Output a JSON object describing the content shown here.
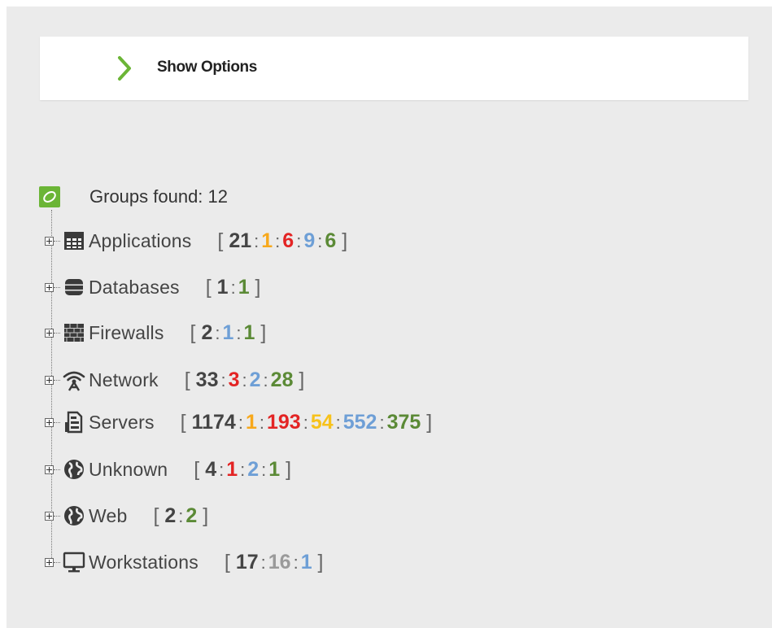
{
  "options": {
    "label": "Show Options"
  },
  "tree": {
    "root_label": "Groups found: 12",
    "groups": [
      {
        "name": "Applications",
        "icon": "applications-grid-icon",
        "counts": [
          {
            "v": "21",
            "c": "#444444"
          },
          {
            "v": "1",
            "c": "#f7a81b"
          },
          {
            "v": "6",
            "c": "#e32424"
          },
          {
            "v": "9",
            "c": "#6e9fd6"
          },
          {
            "v": "6",
            "c": "#5b8a36"
          }
        ]
      },
      {
        "name": "Databases",
        "icon": "database-icon",
        "counts": [
          {
            "v": "1",
            "c": "#444444"
          },
          {
            "v": "1",
            "c": "#5b8a36"
          }
        ]
      },
      {
        "name": "Firewalls",
        "icon": "firewall-brick-icon",
        "counts": [
          {
            "v": "2",
            "c": "#444444"
          },
          {
            "v": "1",
            "c": "#6e9fd6"
          },
          {
            "v": "1",
            "c": "#5b8a36"
          }
        ]
      },
      {
        "name": "Network",
        "icon": "antenna-icon",
        "counts": [
          {
            "v": "33",
            "c": "#444444"
          },
          {
            "v": "3",
            "c": "#e32424"
          },
          {
            "v": "2",
            "c": "#6e9fd6"
          },
          {
            "v": "28",
            "c": "#5b8a36"
          }
        ]
      },
      {
        "name": "Servers",
        "icon": "server-icon",
        "counts": [
          {
            "v": "1174",
            "c": "#444444"
          },
          {
            "v": "1",
            "c": "#f7a81b"
          },
          {
            "v": "193",
            "c": "#e32424"
          },
          {
            "v": "54",
            "c": "#f7c21b"
          },
          {
            "v": "552",
            "c": "#6e9fd6"
          },
          {
            "v": "375",
            "c": "#5b8a36"
          }
        ]
      },
      {
        "name": "Unknown",
        "icon": "globe-icon",
        "counts": [
          {
            "v": "4",
            "c": "#444444"
          },
          {
            "v": "1",
            "c": "#e32424"
          },
          {
            "v": "2",
            "c": "#6e9fd6"
          },
          {
            "v": "1",
            "c": "#5b8a36"
          }
        ]
      },
      {
        "name": "Web",
        "icon": "globe-icon",
        "counts": [
          {
            "v": "2",
            "c": "#444444"
          },
          {
            "v": "2",
            "c": "#5b8a36"
          }
        ]
      },
      {
        "name": "Workstations",
        "icon": "monitor-icon",
        "counts": [
          {
            "v": "17",
            "c": "#444444"
          },
          {
            "v": "16",
            "c": "#9a9a9a"
          },
          {
            "v": "1",
            "c": "#6e9fd6"
          }
        ]
      }
    ]
  }
}
